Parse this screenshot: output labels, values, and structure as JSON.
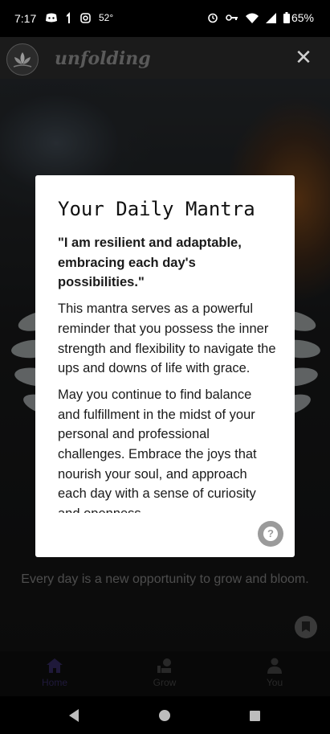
{
  "status_bar": {
    "time": "7:17",
    "temperature": "52°",
    "battery": "65%",
    "icons": [
      "discord-icon",
      "notification-icon",
      "instagram-icon",
      "alarm-icon",
      "vpn-key-icon",
      "wifi-icon",
      "signal-icon",
      "battery-icon"
    ]
  },
  "app_bar": {
    "app_name": "unfolding",
    "close_label": "✕"
  },
  "dialog": {
    "title": "Your Daily Mantra",
    "mantra": "\"I am resilient and adaptable, embracing each day's possibilities.\"",
    "paragraph1": "This mantra serves as a powerful reminder that you possess the inner strength and flexibility to navigate the ups and downs of life with grace.",
    "paragraph2": "May you continue to find balance and fulfillment in the midst of your personal and professional challenges. Embrace the joys that nourish your soul, and approach each day with a sense of curiosity and openness.",
    "help_label": "?"
  },
  "hero": {
    "tagline": "Every day is a new opportunity to grow and bloom."
  },
  "bottom_nav": {
    "items": [
      {
        "label": "Home",
        "icon": "home-icon",
        "active": true
      },
      {
        "label": "Grow",
        "icon": "grow-icon",
        "active": false
      },
      {
        "label": "You",
        "icon": "person-icon",
        "active": false
      }
    ]
  },
  "colors": {
    "accent": "#3a2e6a",
    "dialog_bg": "#ffffff",
    "help_button": "#9b9b9b"
  }
}
